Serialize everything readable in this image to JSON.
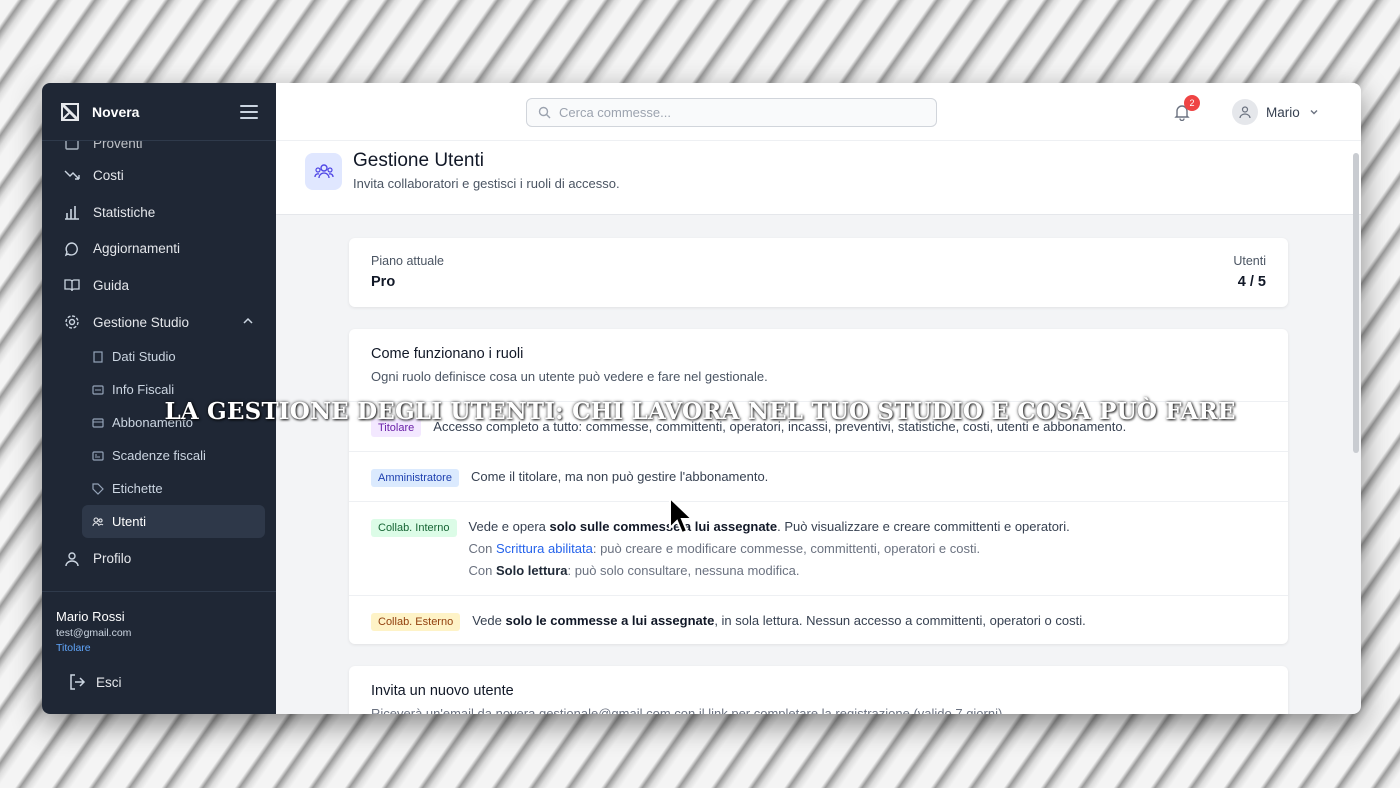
{
  "sidebar": {
    "brand": "Novera",
    "partial_item": "Proventi",
    "items": [
      {
        "label": "Costi",
        "icon": "trend-down-icon"
      },
      {
        "label": "Statistiche",
        "icon": "bar-chart-icon"
      },
      {
        "label": "Aggiornamenti",
        "icon": "chat-bubble-icon"
      },
      {
        "label": "Guida",
        "icon": "book-icon"
      },
      {
        "label": "Gestione Studio",
        "icon": "gear-icon"
      }
    ],
    "sub_items": [
      {
        "label": "Dati Studio",
        "icon": "building-icon"
      },
      {
        "label": "Info Fiscali",
        "icon": "id-card-icon"
      },
      {
        "label": "Abbonamento",
        "icon": "credit-card-icon"
      },
      {
        "label": "Scadenze fiscali",
        "icon": "calendar-card-icon"
      },
      {
        "label": "Etichette",
        "icon": "tag-icon"
      },
      {
        "label": "Utenti",
        "icon": "users-icon"
      }
    ],
    "profile_label": "Profilo",
    "user": {
      "name": "Mario Rossi",
      "email": "test@gmail.com",
      "role": "Titolare"
    },
    "logout_label": "Esci"
  },
  "topbar": {
    "search_placeholder": "Cerca commesse...",
    "notifications_count": "2",
    "user_name": "Mario"
  },
  "page": {
    "title": "Gestione Utenti",
    "subtitle": "Invita collaboratori e gestisci i ruoli di accesso."
  },
  "plan": {
    "label": "Piano attuale",
    "value": "Pro",
    "users_label": "Utenti",
    "users_value": "4 / 5"
  },
  "roles": {
    "title": "Come funzionano i ruoli",
    "subtitle": "Ogni ruolo definisce cosa un utente può vedere e fare nel gestionale.",
    "titolare": {
      "badge": "Titolare",
      "text": "Accesso completo a tutto: commesse, committenti, operatori, incassi, preventivi, statistiche, costi, utenti e abbonamento."
    },
    "admin": {
      "badge": "Amministratore",
      "text": "Come il titolare, ma non può gestire l'abbonamento."
    },
    "interno": {
      "badge": "Collab. Interno",
      "l1_a": "Vede e opera ",
      "l1_b": "solo sulle commesse a lui assegnate",
      "l1_c": ". Può visualizzare e creare committenti e operatori.",
      "l2_a": "Con ",
      "l2_b": "Scrittura abilitata",
      "l2_c": ": può creare e modificare commesse, committenti, operatori e costi.",
      "l3_a": "Con ",
      "l3_b": "Solo lettura",
      "l3_c": ": può solo consultare, nessuna modifica."
    },
    "esterno": {
      "badge": "Collab. Esterno",
      "a": "Vede ",
      "b": "solo le commesse a lui assegnate",
      "c": ", in sola lettura. Nessun accesso a committenti, operatori o costi."
    }
  },
  "invite": {
    "title": "Invita un nuovo utente",
    "subtitle": "Riceverà un'email da novera.gestionale@gmail.com con il link per completare la registrazione (valido 7 giorni)."
  },
  "caption": "LA GESTIONE DEGLI UTENTI: CHI LAVORA NEL TUO STUDIO E COSA PUÒ FARE"
}
